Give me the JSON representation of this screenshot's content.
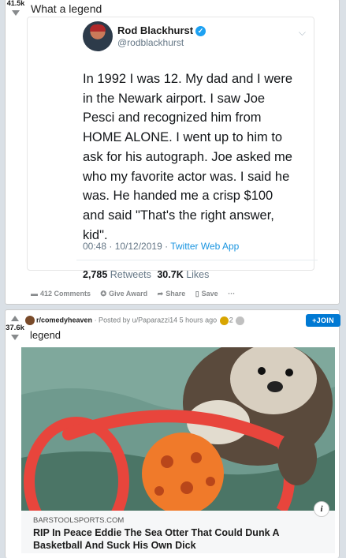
{
  "post1": {
    "score": "41.5k",
    "title": "What a legend",
    "tweet": {
      "name": "Rod Blackhurst",
      "handle": "@rodblackhurst",
      "text": "In 1992 I was 12. My dad and I were in the Newark airport. I saw Joe Pesci and recognized him from HOME ALONE. I went up to him to ask for his autograph. Joe asked me who my favorite actor was. I said he was. He handed me a crisp $100 and said \"That's the right answer, kid\".",
      "time": "00:48 · 10/12/2019 · ",
      "source": "Twitter Web App",
      "retweets_count": "2,785",
      "retweets_label": "Retweets",
      "likes_count": "30.7K",
      "likes_label": "Likes"
    },
    "actions": {
      "comments": "412 Comments",
      "give_award": "Give Award",
      "share": "Share",
      "save": "Save",
      "more": "···"
    }
  },
  "post2": {
    "score": "37.6k",
    "subreddit": "r/comedyheaven",
    "posted_by": "· Posted by u/Paparazzi14 5 hours ago",
    "award_count": "2",
    "join_label": "+JOIN",
    "title": "legend",
    "link_domain": "BARSTOOLSPORTS.COM",
    "link_title": "RIP In Peace Eddie The Sea Otter That Could Dunk A Basketball And Suck His Own Dick",
    "info_icon": "i"
  },
  "colors": {
    "accent": "#0079d3",
    "twitter_blue": "#1da1f2",
    "vote_grey": "#878a8c"
  }
}
